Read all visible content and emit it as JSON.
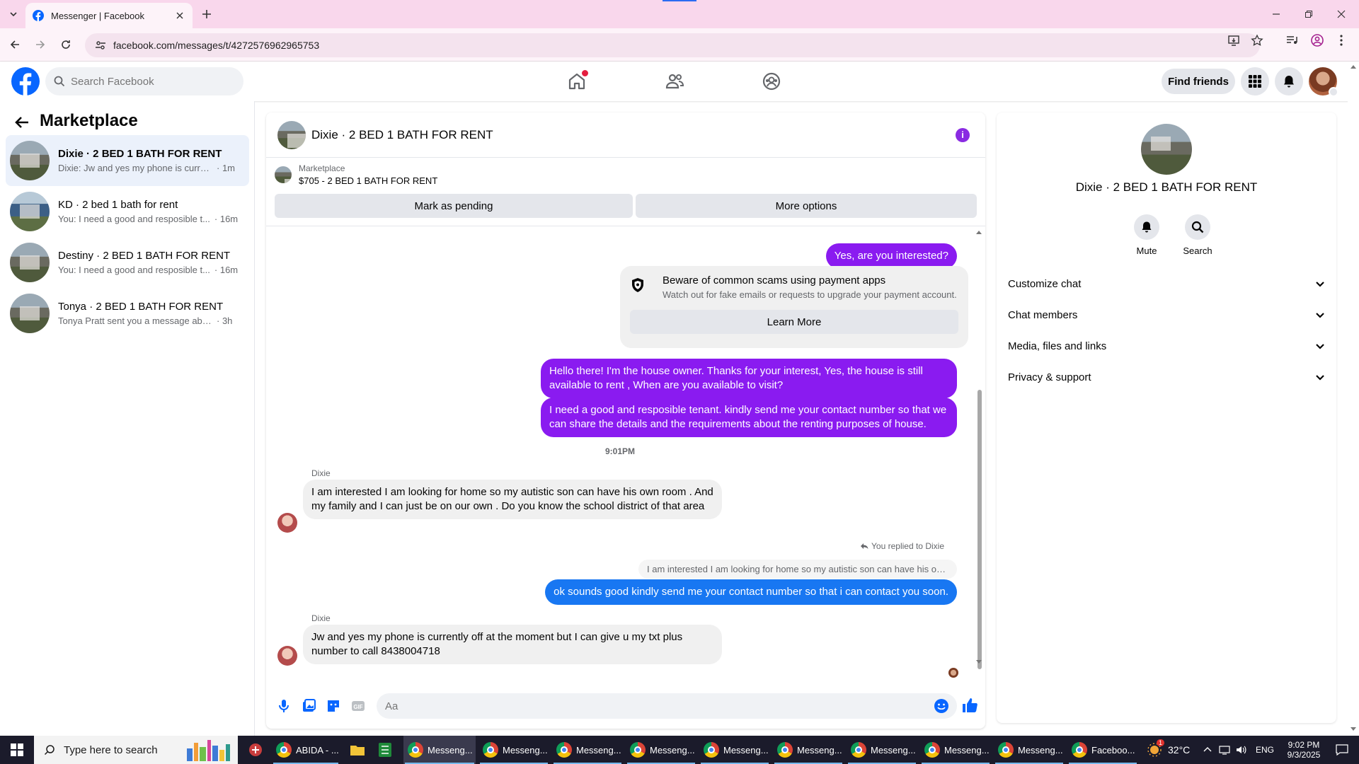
{
  "browser": {
    "tab_title": "Messenger | Facebook",
    "url": "facebook.com/messages/t/4272576962965753"
  },
  "fb": {
    "search_placeholder": "Search Facebook",
    "find_friends": "Find friends"
  },
  "sidebar": {
    "title": "Marketplace",
    "chats": [
      {
        "name": "Dixie · 2 BED 1 BATH FOR RENT",
        "preview": "Dixie: Jw and yes my phone is current...",
        "time": "· 1m"
      },
      {
        "name": "KD · 2 bed 1 bath for rent",
        "preview": "You: I need a good and resposible t...",
        "time": "· 16m"
      },
      {
        "name": "Destiny · 2 BED 1 BATH FOR RENT",
        "preview": "You: I need a good and resposible t...",
        "time": "· 16m"
      },
      {
        "name": "Tonya · 2 BED 1 BATH FOR RENT",
        "preview": "Tonya Pratt sent you a message about...",
        "time": "· 3h"
      }
    ]
  },
  "chat": {
    "title": "Dixie · 2 BED 1 BATH FOR RENT",
    "marketplace_label": "Marketplace",
    "listing": "$705 - 2 BED 1 BATH FOR RENT",
    "mark_pending": "Mark as pending",
    "more_options": "More options",
    "messages": {
      "m1": "Yes, are you interested?",
      "scam_title": "Beware of common scams using payment apps",
      "scam_sub": "Watch out for fake emails or requests to upgrade your payment account.",
      "learn_more": "Learn More",
      "m2": "Hello there! I'm the house owner. Thanks for your interest, Yes, the house is still available to rent , When are you available to visit?",
      "m3": "I need a good and resposible tenant.  kindly send me your contact number so that we can share the details and the requirements about the renting purposes of house.",
      "time1": "9:01PM",
      "sender": "Dixie",
      "m4": "I am interested I am looking for home so my autistic son can have his own room . And my family and I can just be on our own . Do you know the school district of that area",
      "replied_to": "You replied to Dixie",
      "quoted": "I am interested I am looking for home so my autistic son can have his ow...",
      "m5": "ok sounds good kindly  send me your contact number so that i can contact you soon.",
      "m6": "Jw and yes my phone is currently off at the moment but I can give u my txt plus number to call 8438004718"
    },
    "composer_placeholder": "Aa"
  },
  "details": {
    "title": "Dixie · 2 BED 1 BATH FOR RENT",
    "mute": "Mute",
    "search": "Search",
    "sections": [
      "Customize chat",
      "Chat members",
      "Media, files and links",
      "Privacy & support"
    ]
  },
  "taskbar": {
    "search_placeholder": "Type here to search",
    "apps": [
      "ABIDA - ...",
      "Messeng...",
      "Messeng...",
      "Messeng...",
      "Messeng...",
      "Messeng...",
      "Messeng...",
      "Messeng...",
      "Messeng...",
      "Messeng...",
      "Faceboo..."
    ],
    "weather": "32°C",
    "lang": "ENG",
    "time": "9:02 PM",
    "date": "9/3/2025",
    "badge": "1"
  },
  "colors": {
    "accent_purple": "#8a1bf0",
    "messenger_blue": "#1877f2",
    "fb_blue": "#0866ff"
  }
}
